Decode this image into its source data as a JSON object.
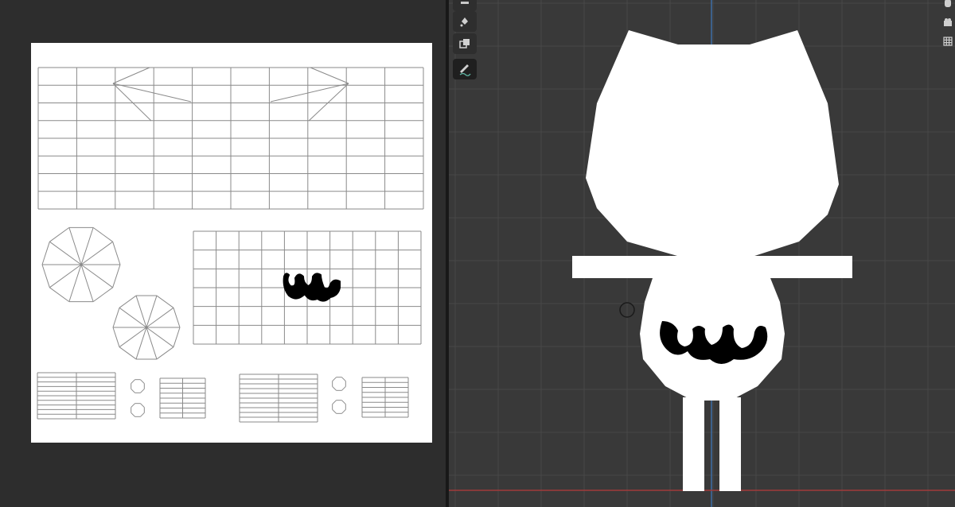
{
  "uv_editor": {
    "canvas_bg": "#ffffff",
    "wire_color": "#8a8a8a",
    "paint_color": "#000000"
  },
  "viewport": {
    "bg": "#393939",
    "grid_color": "#474747",
    "axis_y_color": "#3e6ea6",
    "axis_x_color": "#a03a3a",
    "model_color": "#ffffff"
  },
  "toolbar": {
    "tools": [
      {
        "name": "fill-tool",
        "icon": "fill-icon"
      },
      {
        "name": "clone-tool",
        "icon": "clone-icon"
      },
      {
        "name": "annotate-tool",
        "icon": "annotate-icon",
        "active": true
      }
    ]
  },
  "right_tools": [
    {
      "icon": "hand-icon"
    },
    {
      "icon": "camera-icon"
    },
    {
      "icon": "grid-view-icon"
    }
  ]
}
